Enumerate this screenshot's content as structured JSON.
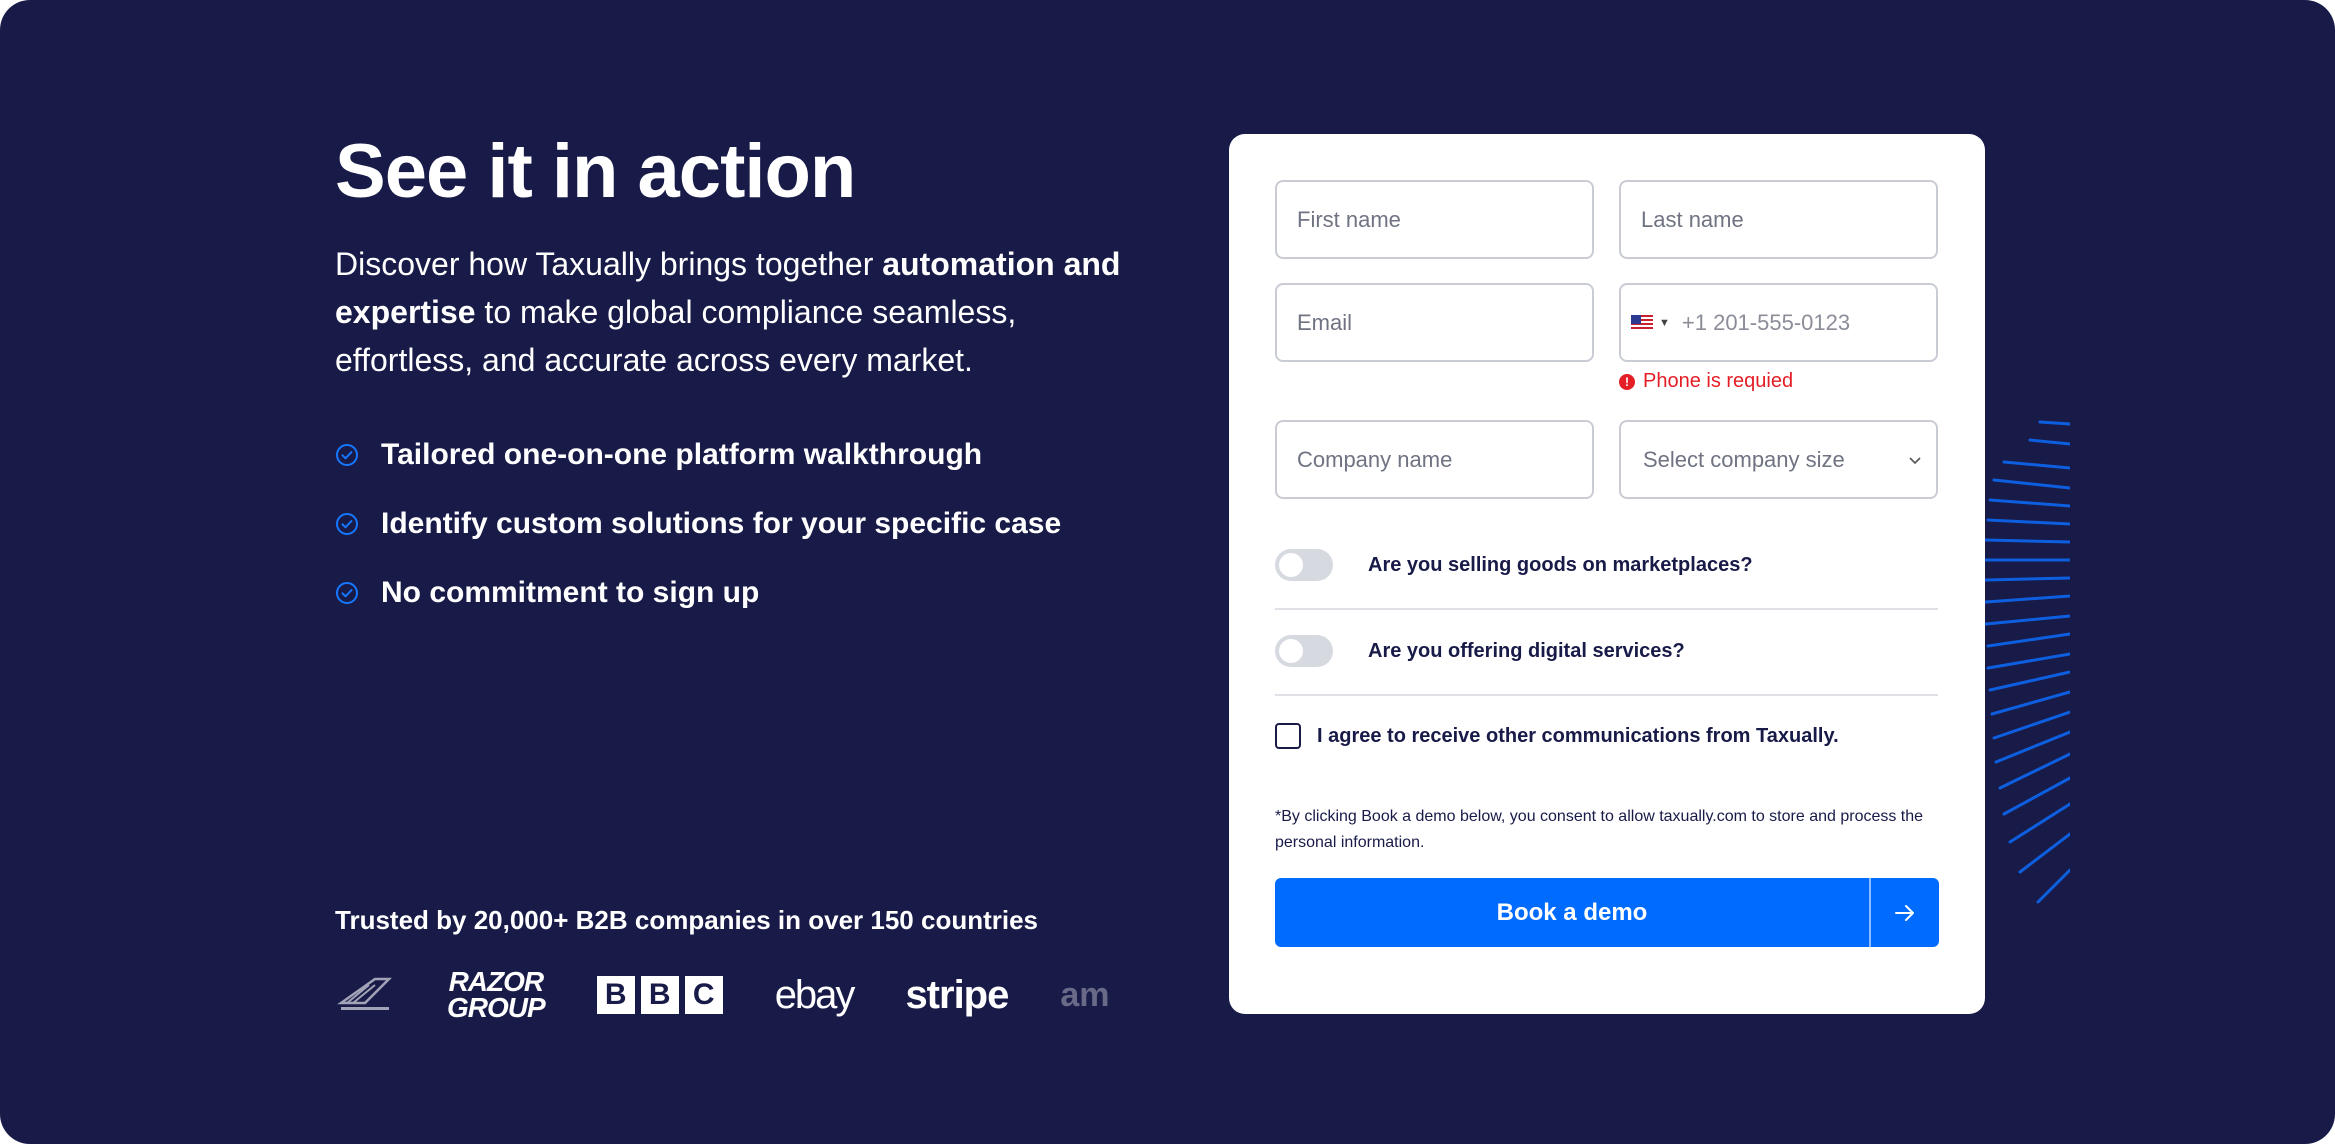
{
  "hero": {
    "headline": "See it in action",
    "intro_a": "Discover how Taxually brings together ",
    "intro_bold": "automation and expertise",
    "intro_b": " to make global compliance seamless, effortless, and accurate across every market.",
    "features": [
      "Tailored one-on-one platform walkthrough",
      "Identify custom solutions for your specific case",
      "No commitment to sign up"
    ]
  },
  "trusted": {
    "text": "Trusted by 20,000+ B2B companies in over 150 countries",
    "logos": {
      "razor": "RAZOR GROUP",
      "bbc": [
        "B",
        "B",
        "C"
      ],
      "ebay": "ebay",
      "stripe": "stripe",
      "amazon": "am"
    },
    "logo_icons": [
      "sports-logo-icon"
    ]
  },
  "form": {
    "first_name_placeholder": "First name",
    "last_name_placeholder": "Last name",
    "email_placeholder": "Email",
    "phone_placeholder": "+1 201-555-0123",
    "phone_country_icon": "us-flag-icon",
    "phone_error": "Phone is requied",
    "company_name_placeholder": "Company name",
    "company_size_select": "Select company size",
    "toggle_marketplaces": "Are you selling goods on marketplaces?",
    "toggle_digital": "Are you offering digital services?",
    "agree_label": "I agree to receive other communications from Taxually.",
    "consent": "*By clicking Book a demo below, you consent to allow taxually.com to store and process the personal information.",
    "submit_label": "Book a demo"
  },
  "colors": {
    "background": "#181a48",
    "accent": "#006cff",
    "error": "#e41e26",
    "card": "#ffffff"
  }
}
